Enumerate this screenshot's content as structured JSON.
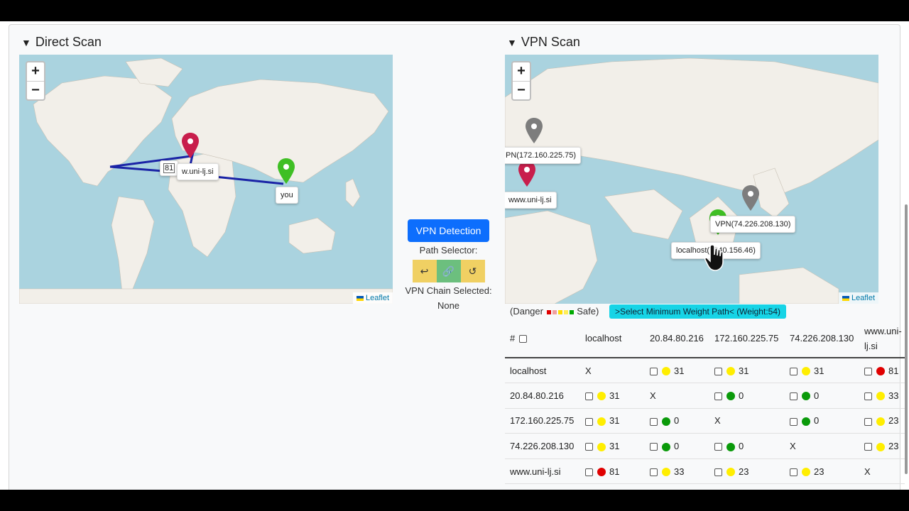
{
  "direct": {
    "title": "Direct Scan",
    "zoom_in": "+",
    "zoom_out": "−",
    "attribution": "Leaflet",
    "route_label": "81",
    "dest_label": "w.uni-lj.si",
    "you_label": "you"
  },
  "vpn": {
    "title": "VPN Scan",
    "zoom_in": "+",
    "zoom_out": "−",
    "attribution": "Leaflet",
    "labels": {
      "vpn1": "PN(172.160.225.75)",
      "dest": "www.uni-lj.si",
      "vpn2": "VPN(74.226.208.130)",
      "localhost": "localhost(   .240.156.46)"
    }
  },
  "center": {
    "vpn_button": "VPN Detection",
    "path_selector": "Path Selector:",
    "chain_label": "VPN Chain Selected:",
    "chain_value": "None",
    "btn_left": "↩",
    "btn_mid": "🔗",
    "btn_right": "↺"
  },
  "legend": {
    "danger": "(Danger",
    "safe": "Safe)",
    "colors": [
      "#e00000",
      "#f0a0a0",
      "#ffdd00",
      "#ffee55",
      "#00aa00"
    ]
  },
  "min_path_button": ">Select Minimum Weight Path< (Weight:54)",
  "colors": {
    "red": "#e00000",
    "yellow": "#ffee00",
    "green": "#0a9a0a"
  },
  "table": {
    "corner": "#",
    "headers": [
      "localhost",
      "20.84.80.216",
      "172.160.225.75",
      "74.226.208.130",
      "www.uni-lj.si"
    ],
    "rows": [
      {
        "label": "localhost",
        "cells": [
          {
            "x": "X"
          },
          {
            "color": "yellow",
            "v": "31"
          },
          {
            "color": "yellow",
            "v": "31"
          },
          {
            "color": "yellow",
            "v": "31"
          },
          {
            "color": "red",
            "v": "81"
          }
        ]
      },
      {
        "label": "20.84.80.216",
        "cells": [
          {
            "color": "yellow",
            "v": "31"
          },
          {
            "x": "X"
          },
          {
            "color": "green",
            "v": "0"
          },
          {
            "color": "green",
            "v": "0"
          },
          {
            "color": "yellow",
            "v": "33"
          }
        ]
      },
      {
        "label": "172.160.225.75",
        "cells": [
          {
            "color": "yellow",
            "v": "31"
          },
          {
            "color": "green",
            "v": "0"
          },
          {
            "x": "X"
          },
          {
            "color": "green",
            "v": "0"
          },
          {
            "color": "yellow",
            "v": "23"
          }
        ]
      },
      {
        "label": "74.226.208.130",
        "cells": [
          {
            "color": "yellow",
            "v": "31"
          },
          {
            "color": "green",
            "v": "0"
          },
          {
            "color": "green",
            "v": "0"
          },
          {
            "x": "X"
          },
          {
            "color": "yellow",
            "v": "23"
          }
        ]
      },
      {
        "label": "www.uni-lj.si",
        "cells": [
          {
            "color": "red",
            "v": "81"
          },
          {
            "color": "yellow",
            "v": "33"
          },
          {
            "color": "yellow",
            "v": "23"
          },
          {
            "color": "yellow",
            "v": "23"
          },
          {
            "x": "X"
          }
        ]
      }
    ]
  }
}
